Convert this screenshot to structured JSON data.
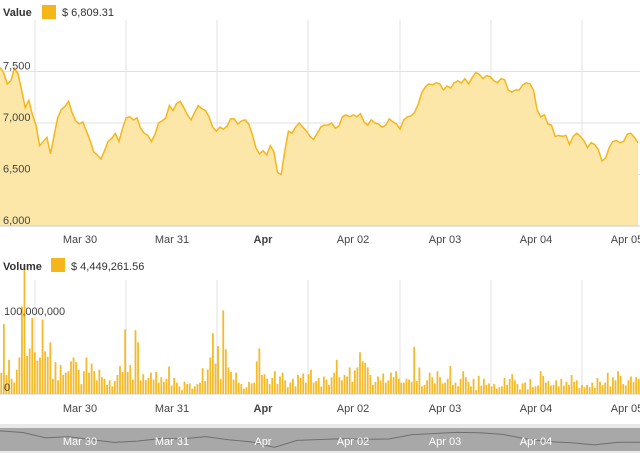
{
  "colors": {
    "accent": "#f5b619",
    "area_fill": "#fde7a8",
    "bar_fill": "#f4ba2a",
    "grid": "#e2e2e2",
    "navigator_bg": "#e8e8e8",
    "navigator_band": "#9c9c9c"
  },
  "legend": {
    "value_label": "Value",
    "value_readout": "$ 6,809.31",
    "volume_label": "Volume",
    "volume_readout": "$ 4,449,261.56"
  },
  "chart_data": [
    {
      "type": "area",
      "series": [
        {
          "name": "Value",
          "values": [
            7540,
            7490,
            7380,
            7410,
            7530,
            7480,
            7320,
            7150,
            7220,
            7080,
            6980,
            6780,
            6820,
            6860,
            6700,
            6880,
            7050,
            7130,
            7160,
            7210,
            7100,
            7020,
            6990,
            7010,
            6920,
            6830,
            6720,
            6690,
            6650,
            6730,
            6820,
            6850,
            6900,
            6820,
            6950,
            7050,
            7060,
            7030,
            7050,
            6950,
            6900,
            6880,
            6820,
            6890,
            7000,
            7020,
            7050,
            7170,
            7120,
            7190,
            7210,
            7150,
            7080,
            7030,
            7100,
            7170,
            7140,
            7120,
            7060,
            6960,
            6920,
            6960,
            6940,
            6970,
            7040,
            7040,
            6990,
            7020,
            7030,
            6990,
            6890,
            6760,
            6700,
            6730,
            6690,
            6780,
            6720,
            6520,
            6500,
            6730,
            6920,
            6900,
            6960,
            7000,
            6960,
            6920,
            6870,
            6840,
            6900,
            6960,
            6980,
            6980,
            7000,
            6950,
            6970,
            7060,
            7080,
            7060,
            7080,
            7060,
            7090,
            7010,
            6980,
            7030,
            7000,
            6990,
            6960,
            6980,
            7040,
            7010,
            6990,
            6940,
            7030,
            7060,
            7070,
            7100,
            7180,
            7290,
            7350,
            7380,
            7370,
            7390,
            7380,
            7320,
            7360,
            7340,
            7390,
            7410,
            7390,
            7430,
            7380,
            7440,
            7490,
            7470,
            7430,
            7460,
            7450,
            7410,
            7390,
            7430,
            7420,
            7320,
            7300,
            7320,
            7320,
            7370,
            7390,
            7380,
            7320,
            7130,
            7060,
            7080,
            6990,
            6980,
            6870,
            6880,
            6870,
            6880,
            6790,
            6870,
            6900,
            6870,
            6830,
            6760,
            6810,
            6790,
            6740,
            6630,
            6660,
            6760,
            6820,
            6830,
            6810,
            6820,
            6890,
            6900,
            6860,
            6809
          ]
        }
      ],
      "y_ticks": [
        "6,000",
        "6,500",
        "7,000",
        "7,500"
      ],
      "ylim": [
        6000,
        8000
      ]
    },
    {
      "type": "bar",
      "series": [
        {
          "name": "Volume",
          "values": [
            28,
            92,
            25,
            45,
            20,
            15,
            32,
            48,
            115,
            170,
            50,
            60,
            100,
            55,
            44,
            48,
            98,
            56,
            49,
            68,
            20,
            42,
            18,
            38,
            25,
            28,
            30,
            43,
            48,
            42,
            32,
            13,
            30,
            48,
            28,
            40,
            30,
            18,
            32,
            22,
            20,
            12,
            18,
            10,
            17,
            25,
            37,
            29,
            85,
            29,
            38,
            19,
            84,
            68,
            18,
            26,
            18,
            21,
            28,
            19,
            29,
            15,
            22,
            16,
            20,
            36,
            11,
            21,
            15,
            10,
            5,
            16,
            13,
            14,
            7,
            10,
            13,
            15,
            34,
            17,
            32,
            48,
            80,
            40,
            63,
            20,
            110,
            59,
            35,
            29,
            19,
            28,
            15,
            13,
            7,
            9,
            16,
            14,
            15,
            43,
            60,
            25,
            26,
            20,
            13,
            21,
            30,
            13,
            23,
            28,
            18,
            9,
            15,
            20,
            10,
            25,
            21,
            27,
            15,
            26,
            32,
            15,
            17,
            21,
            10,
            23,
            19,
            12,
            22,
            28,
            45,
            22,
            18,
            25,
            23,
            35,
            16,
            31,
            35,
            55,
            43,
            41,
            35,
            25,
            12,
            16,
            23,
            18,
            27,
            15,
            18,
            28,
            22,
            30,
            20,
            15,
            15,
            20,
            19,
            16,
            62,
            17,
            35,
            10,
            12,
            18,
            28,
            22,
            14,
            30,
            22,
            14,
            15,
            20,
            37,
            12,
            15,
            10,
            20,
            30,
            22,
            16,
            10,
            20,
            5,
            24,
            11,
            20,
            12,
            14,
            10,
            13,
            7,
            9,
            10,
            21,
            12,
            20,
            26,
            18,
            13,
            6,
            14,
            15,
            6,
            20,
            9,
            10,
            11,
            30,
            24,
            15,
            17,
            11,
            12,
            18,
            10,
            20,
            11,
            16,
            12,
            25,
            16,
            18,
            8,
            12,
            9,
            12,
            9,
            15,
            8,
            21,
            16,
            12,
            15,
            28,
            10,
            22,
            18,
            30,
            24,
            13,
            11,
            18,
            23,
            16,
            22,
            20
          ]
        }
      ],
      "y_ticks": [
        "0",
        "100,000,000"
      ],
      "ylim": [
        0,
        150
      ]
    }
  ],
  "x_axis": {
    "ticks": [
      "Mar 30",
      "Mar 31",
      "Apr",
      "Apr 02",
      "Apr 03",
      "Apr 04",
      "Apr 05"
    ],
    "bold_tick": "Apr"
  },
  "navigator": {
    "ticks": [
      "Mar 30",
      "Mar 31",
      "Apr",
      "Apr 02",
      "Apr 03",
      "Apr 04"
    ],
    "values": [
      7540,
      7440,
      7100,
      7180,
      6980,
      6820,
      6900,
      7060,
      7050,
      7180,
      6980,
      6850,
      6500,
      6940,
      7000,
      7050,
      7010,
      7030,
      7300,
      7380,
      7450,
      7430,
      7320,
      7040,
      6870,
      6790,
      6660,
      6820,
      6830
    ]
  }
}
